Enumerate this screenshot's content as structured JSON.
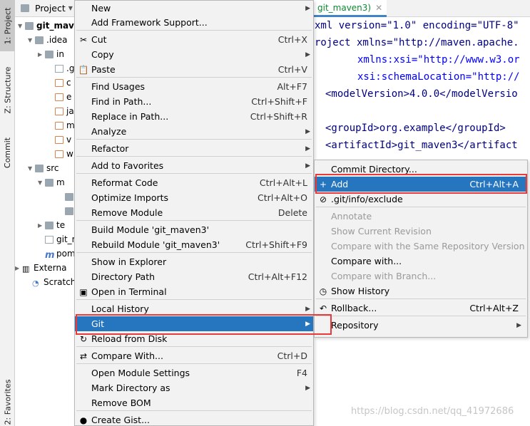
{
  "tool_strip": {
    "project_tab": "1: Project",
    "structure_tab": "Z: Structure",
    "commit_tab": "Commit",
    "favorites_tab": "2: Favorites"
  },
  "project_panel": {
    "header": "Project",
    "rows": [
      {
        "label": "git_mav",
        "icon": "folder-icon",
        "bold": true
      },
      {
        "label": ".idea",
        "icon": "folder-icon"
      },
      {
        "label": "in",
        "icon": "folder-icon"
      },
      {
        "label": ".g",
        "icon": "file-icon"
      },
      {
        "label": "c",
        "icon": "xml-file-icon"
      },
      {
        "label": "e",
        "icon": "xml-file-icon"
      },
      {
        "label": "ja",
        "icon": "xml-file-icon"
      },
      {
        "label": "m",
        "icon": "xml-file-icon"
      },
      {
        "label": "v",
        "icon": "xml-file-icon"
      },
      {
        "label": "w",
        "icon": "xml-file-icon"
      },
      {
        "label": "src",
        "icon": "folder-icon"
      },
      {
        "label": "m",
        "icon": "folder-icon"
      },
      {
        "label": "",
        "icon": "folder-icon"
      },
      {
        "label": "",
        "icon": "folder-icon"
      },
      {
        "label": "te",
        "icon": "folder-icon"
      },
      {
        "label": "git_m",
        "icon": "file-icon"
      },
      {
        "label": "pom",
        "icon": "maven-icon"
      },
      {
        "label": "Externa",
        "icon": "library-icon"
      },
      {
        "label": "Scratch",
        "icon": "scratch-icon"
      }
    ]
  },
  "editor": {
    "tab_label": "git_maven3)",
    "lines": [
      "xml version=\"1.0\" encoding=\"UTF-8\"",
      "roject xmlns=\"http://maven.apache.",
      "xmlns:xsi=\"http://www.w3.or",
      "xsi:schemaLocation=\"http://",
      "<modelVersion>4.0.0</modelVersio",
      "<groupId>org.example</groupId>",
      "<artifactId>git_maven3</artifact"
    ]
  },
  "context_menu": {
    "items": [
      {
        "label": "New",
        "shortcut": "",
        "submenu": true,
        "icon": ""
      },
      {
        "label": "Add Framework Support...",
        "shortcut": "",
        "submenu": false,
        "icon": ""
      },
      {
        "label": "Cut",
        "shortcut": "Ctrl+X",
        "submenu": false,
        "icon": "scissors-icon"
      },
      {
        "label": "Copy",
        "shortcut": "",
        "submenu": true,
        "icon": ""
      },
      {
        "label": "Paste",
        "shortcut": "Ctrl+V",
        "submenu": false,
        "icon": "clipboard-icon"
      },
      {
        "label": "Find Usages",
        "shortcut": "Alt+F7",
        "submenu": false,
        "icon": ""
      },
      {
        "label": "Find in Path...",
        "shortcut": "Ctrl+Shift+F",
        "submenu": false,
        "icon": ""
      },
      {
        "label": "Replace in Path...",
        "shortcut": "Ctrl+Shift+R",
        "submenu": false,
        "icon": ""
      },
      {
        "label": "Analyze",
        "shortcut": "",
        "submenu": true,
        "icon": ""
      },
      {
        "label": "Refactor",
        "shortcut": "",
        "submenu": true,
        "icon": ""
      },
      {
        "label": "Add to Favorites",
        "shortcut": "",
        "submenu": true,
        "icon": ""
      },
      {
        "label": "Reformat Code",
        "shortcut": "Ctrl+Alt+L",
        "submenu": false,
        "icon": ""
      },
      {
        "label": "Optimize Imports",
        "shortcut": "Ctrl+Alt+O",
        "submenu": false,
        "icon": ""
      },
      {
        "label": "Remove Module",
        "shortcut": "Delete",
        "submenu": false,
        "icon": ""
      },
      {
        "label": "Build Module 'git_maven3'",
        "shortcut": "",
        "submenu": false,
        "icon": ""
      },
      {
        "label": "Rebuild Module 'git_maven3'",
        "shortcut": "Ctrl+Shift+F9",
        "submenu": false,
        "icon": ""
      },
      {
        "label": "Show in Explorer",
        "shortcut": "",
        "submenu": false,
        "icon": ""
      },
      {
        "label": "Directory Path",
        "shortcut": "Ctrl+Alt+F12",
        "submenu": false,
        "icon": ""
      },
      {
        "label": "Open in Terminal",
        "shortcut": "",
        "submenu": false,
        "icon": "terminal-icon"
      },
      {
        "label": "Local History",
        "shortcut": "",
        "submenu": true,
        "icon": ""
      },
      {
        "label": "Git",
        "shortcut": "",
        "submenu": true,
        "icon": "",
        "selected": true
      },
      {
        "label": "Reload from Disk",
        "shortcut": "",
        "submenu": false,
        "icon": "reload-icon"
      },
      {
        "label": "Compare With...",
        "shortcut": "Ctrl+D",
        "submenu": false,
        "icon": "compare-icon"
      },
      {
        "label": "Open Module Settings",
        "shortcut": "F4",
        "submenu": false,
        "icon": ""
      },
      {
        "label": "Mark Directory as",
        "shortcut": "",
        "submenu": true,
        "icon": ""
      },
      {
        "label": "Remove BOM",
        "shortcut": "",
        "submenu": false,
        "icon": ""
      },
      {
        "label": "Create Gist...",
        "shortcut": "",
        "submenu": false,
        "icon": "github-icon"
      }
    ]
  },
  "git_menu": {
    "items": [
      {
        "label": "Commit Directory...",
        "shortcut": "",
        "disabled": false,
        "icon": ""
      },
      {
        "label": "Add",
        "shortcut": "Ctrl+Alt+A",
        "disabled": false,
        "icon": "plus-icon",
        "selected": true
      },
      {
        "label": ".git/info/exclude",
        "shortcut": "",
        "disabled": false,
        "icon": "ignore-file-icon"
      },
      {
        "label": "Annotate",
        "shortcut": "",
        "disabled": true,
        "icon": ""
      },
      {
        "label": "Show Current Revision",
        "shortcut": "",
        "disabled": true,
        "icon": ""
      },
      {
        "label": "Compare with the Same Repository Version",
        "shortcut": "",
        "disabled": true,
        "icon": ""
      },
      {
        "label": "Compare with...",
        "shortcut": "",
        "disabled": false,
        "icon": ""
      },
      {
        "label": "Compare with Branch...",
        "shortcut": "",
        "disabled": true,
        "icon": ""
      },
      {
        "label": "Show History",
        "shortcut": "",
        "disabled": false,
        "icon": "history-icon"
      },
      {
        "label": "Rollback...",
        "shortcut": "Ctrl+Alt+Z",
        "disabled": false,
        "icon": "rollback-icon"
      },
      {
        "label": "Repository",
        "shortcut": "",
        "disabled": false,
        "icon": "",
        "submenu": true
      }
    ]
  },
  "watermark": "https://blog.csdn.net/qq_41972686",
  "colors": {
    "selection": "#2675bf",
    "highlight_box": "#e83a3a",
    "menu_bg": "#f2f2f2"
  }
}
